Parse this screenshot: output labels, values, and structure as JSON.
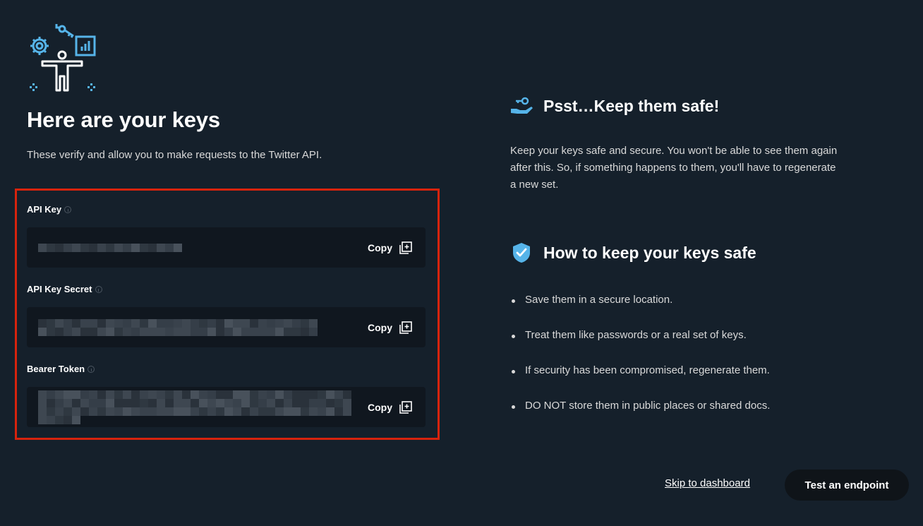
{
  "header": {
    "illustration": "person-with-gear-key-chart-icon",
    "title": "Here are your keys",
    "subtitle": "These verify and allow you to make requests to the Twitter API."
  },
  "keys": [
    {
      "label": "API Key",
      "value_state": "redacted",
      "copy_label": "Copy"
    },
    {
      "label": "API Key Secret",
      "value_state": "redacted",
      "copy_label": "Copy"
    },
    {
      "label": "Bearer Token",
      "value_state": "redacted",
      "copy_label": "Copy"
    }
  ],
  "safety": {
    "heading": "Psst…Keep them safe!",
    "heading_icon": "hand-holding-key-icon",
    "body": "Keep your keys safe and secure. You won't be able to see them again after this. So, if something happens to them, you'll have to regenerate a new set."
  },
  "howto": {
    "heading": "How to keep your keys safe",
    "heading_icon": "shield-check-icon",
    "tips": [
      "Save them in a secure location.",
      "Treat them like passwords or a real set of keys.",
      "If security has been compromised, regenerate them.",
      "DO NOT store them in public places or shared docs."
    ]
  },
  "actions": {
    "skip_label": "Skip to dashboard",
    "test_label": "Test an endpoint"
  },
  "colors": {
    "background": "#15202b",
    "field": "#10171f",
    "accent_blue": "#56b4e9",
    "highlight_red": "#d7230d"
  }
}
